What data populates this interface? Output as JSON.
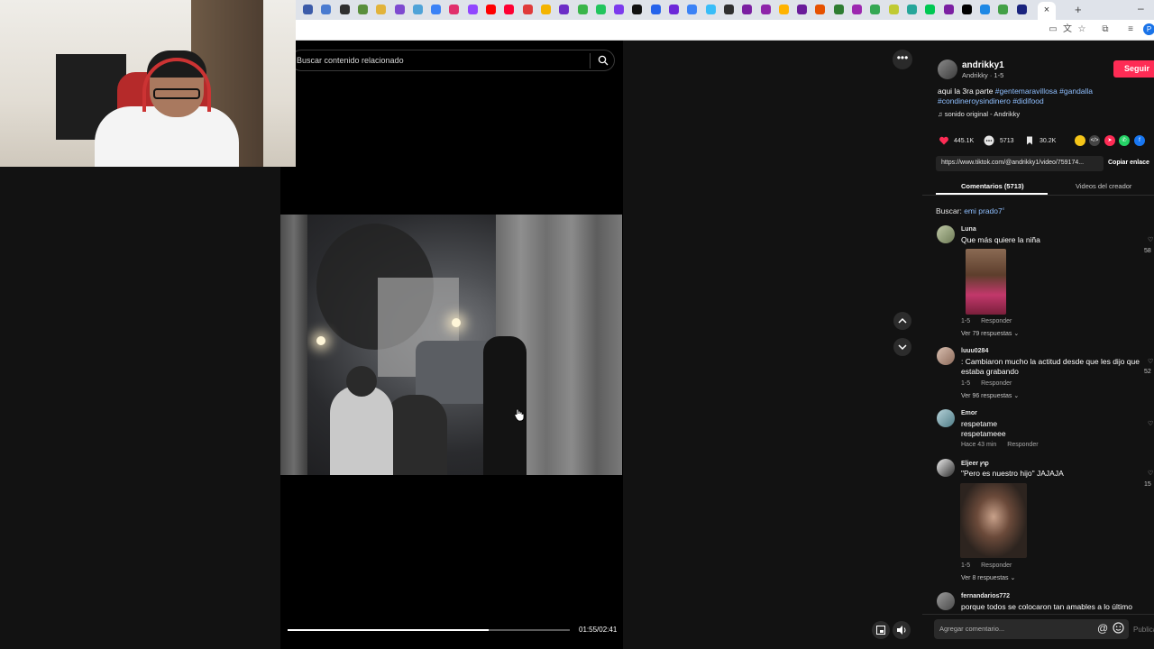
{
  "browser": {
    "active_tab_close": "×",
    "new_tab": "+",
    "minimize": "–",
    "profile_initial": "P",
    "tab_colors": [
      "#3b5ba9",
      "#4a7bd0",
      "#2f2f2f",
      "#5a8f3c",
      "#e2b33a",
      "#7e4ad0",
      "#4fa3d8",
      "#3b82f6",
      "#e1306c",
      "#9146ff",
      "#ff0000",
      "#ff0033",
      "#e03a3a",
      "#f4b400",
      "#6c2dc7",
      "#3ab54a",
      "#22c55e",
      "#7c3aed",
      "#111111",
      "#2563eb",
      "#6d28d9",
      "#3b82f6",
      "#38bdf8",
      "#2f2f2f",
      "#7b1fa2",
      "#8e24aa",
      "#ffb300",
      "#6a1b9a",
      "#e65100",
      "#2e7d32",
      "#9c27b0",
      "#34a853",
      "#c0ca33",
      "#26a69a",
      "#00c853",
      "#7b1fa2",
      "#000000",
      "#1e88e5",
      "#43a047",
      "#1a237e",
      "#c2185b",
      "#6a1b9a",
      "#2b2b2b",
      "#e65100"
    ]
  },
  "video": {
    "search_placeholder": "Buscar contenido relacionado",
    "time": "01:55/02:41",
    "progress": 0.714
  },
  "post": {
    "username": "andrikky1",
    "subname": "Andrikky · 1-5",
    "follow_label": "Seguir",
    "desc_prefix": "aqui la 3ra parte ",
    "tags": [
      "#gentemaravillosa",
      "#gandalla",
      "#condineroysindinero",
      "#didifood"
    ],
    "sound": "sonido original - Andrikky",
    "likes": "445.1K",
    "comments_count": "5713",
    "saves": "30.2K",
    "link": "https://www.tiktok.com/@andrikky1/video/759174...",
    "copy_link": "Copiar enlace"
  },
  "tabs": {
    "comments": "Comentarios (5713)",
    "videos": "Videos del creador"
  },
  "search_hint": {
    "label": "Buscar:",
    "query": "emi prado7"
  },
  "comments": [
    {
      "name": "Luna",
      "text": "Que más quiere la niña",
      "meta": "1-5",
      "reply": "Responder",
      "replies": "Ver 79 respuestas",
      "likes": "58"
    },
    {
      "name": "luuu0284",
      "text": ": Cambiaron mucho la actitud desde que les dijo que estaba grabando",
      "meta": "1-5",
      "reply": "Responder",
      "replies": "Ver 96 respuestas",
      "likes": "52"
    },
    {
      "name": "Emor",
      "text": "respetame\nrespetameee",
      "meta": "Hace 43 min",
      "reply": "Responder",
      "replies": "",
      "likes": ""
    },
    {
      "name": "Eljeer ꝩꝕ",
      "text": "\"Pero es nuestro hijo\" JAJAJA",
      "meta": "1-5",
      "reply": "Responder",
      "replies": "Ver 8 respuestas",
      "likes": "15"
    },
    {
      "name": "fernandarios772",
      "text": "porque todos se colocaron tan amables a lo último",
      "meta": "",
      "reply": "",
      "replies": "",
      "likes": ""
    }
  ],
  "composer": {
    "placeholder": "Agregar comentario...",
    "at": "@",
    "post": "Publicar"
  },
  "colors": {
    "accent": "#fe2c55",
    "tag": "#8fbfff",
    "background": "#121212"
  }
}
